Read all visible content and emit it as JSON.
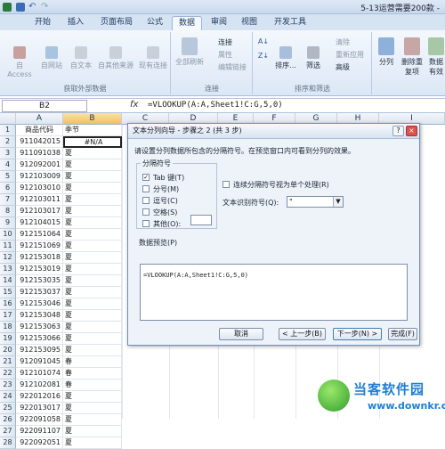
{
  "window": {
    "title": "5-13运营需要200款 -"
  },
  "tabs": [
    "开始",
    "插入",
    "页面布局",
    "公式",
    "数据",
    "审阅",
    "视图",
    "开发工具"
  ],
  "active_tab": 4,
  "ribbon": {
    "external": {
      "label": "获取外部数据",
      "buttons": [
        "自 Access",
        "自网站",
        "自文本",
        "自其他来源",
        "现有连接"
      ]
    },
    "connections": {
      "label": "连接",
      "refresh": "全部刷新",
      "items": [
        "连接",
        "属性",
        "编辑链接"
      ]
    },
    "sort": {
      "label": "排序和筛选",
      "sort": "排序...",
      "filter": "筛选",
      "items": [
        "清除",
        "重新应用",
        "高级"
      ]
    },
    "tools": {
      "split": "分列",
      "remove_dup": "删除重复项",
      "valid": "数据有效"
    }
  },
  "formula_bar": {
    "name_box": "B2",
    "fx": "fx",
    "formula": "=VLOOKUP(A:A,Sheet1!C:G,5,0)"
  },
  "columns": [
    "A",
    "B",
    "C",
    "D",
    "E",
    "F",
    "G",
    "H",
    "I"
  ],
  "rows": [
    {
      "num": "1",
      "a": "商品代码",
      "b": "季节"
    },
    {
      "num": "2",
      "a": "911042015",
      "b": "#N/A"
    },
    {
      "num": "3",
      "a": "911091038",
      "b": "夏"
    },
    {
      "num": "4",
      "a": "912092001",
      "b": "夏"
    },
    {
      "num": "5",
      "a": "912103009",
      "b": "夏"
    },
    {
      "num": "6",
      "a": "912103010",
      "b": "夏"
    },
    {
      "num": "7",
      "a": "912103011",
      "b": "夏"
    },
    {
      "num": "8",
      "a": "912103017",
      "b": "夏"
    },
    {
      "num": "9",
      "a": "912104015",
      "b": "夏"
    },
    {
      "num": "10",
      "a": "912151064",
      "b": "夏"
    },
    {
      "num": "11",
      "a": "912151069",
      "b": "夏"
    },
    {
      "num": "12",
      "a": "912153018",
      "b": "夏"
    },
    {
      "num": "13",
      "a": "912153019",
      "b": "夏"
    },
    {
      "num": "14",
      "a": "912153035",
      "b": "夏"
    },
    {
      "num": "15",
      "a": "912153037",
      "b": "夏"
    },
    {
      "num": "16",
      "a": "912153046",
      "b": "夏"
    },
    {
      "num": "17",
      "a": "912153048",
      "b": "夏"
    },
    {
      "num": "18",
      "a": "912153063",
      "b": "夏"
    },
    {
      "num": "19",
      "a": "912153066",
      "b": "夏"
    },
    {
      "num": "20",
      "a": "912153095",
      "b": "夏"
    },
    {
      "num": "21",
      "a": "912091045",
      "b": "春"
    },
    {
      "num": "22",
      "a": "912101074",
      "b": "春"
    },
    {
      "num": "23",
      "a": "912102081",
      "b": "春"
    },
    {
      "num": "24",
      "a": "922012016",
      "b": "夏"
    },
    {
      "num": "25",
      "a": "922013017",
      "b": "夏"
    },
    {
      "num": "26",
      "a": "922091058",
      "b": "夏"
    },
    {
      "num": "27",
      "a": "922091107",
      "b": "夏"
    },
    {
      "num": "28",
      "a": "922092051",
      "b": "夏"
    }
  ],
  "dialog": {
    "title": "文本分列向导 - 步骤之 2 (共 3 步)",
    "help": "?",
    "close": "×",
    "instruction": "请设置分列数据所包含的分隔符号。在预览窗口内可看到分列的效果。",
    "group_label": "分隔符号",
    "options": [
      {
        "label": "Tab 键(T)",
        "checked": true
      },
      {
        "label": "分号(M)",
        "checked": false
      },
      {
        "label": "逗号(C)",
        "checked": false
      },
      {
        "label": "空格(S)",
        "checked": false
      },
      {
        "label": "其他(O):",
        "checked": false
      }
    ],
    "consecutive": "连续分隔符号视为单个处理(R)",
    "qualifier_label": "文本识别符号(Q):",
    "qualifier_value": "\"",
    "preview_label": "数据预览(P)",
    "preview_text": "=VLOOKUP(A:A,Sheet1!C:G,5,0)",
    "buttons": {
      "cancel": "取消",
      "back": "< 上一步(B)",
      "next": "下一步(N) >",
      "finish": "完成(F)"
    }
  },
  "watermark": {
    "cn": "当客软件园",
    "en": "www.downkr.com"
  }
}
